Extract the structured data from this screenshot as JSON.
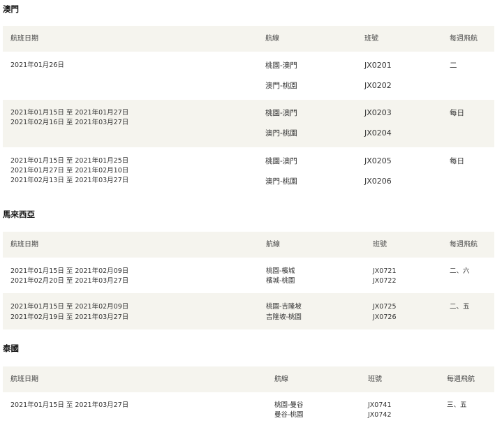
{
  "macau": {
    "title": "澳門",
    "headers": {
      "date": "航班日期",
      "route": "航線",
      "flight": "班號",
      "weekly": "每週飛航"
    },
    "rows": [
      {
        "dates": [
          "2021年01月26日"
        ],
        "routes": [
          "桃園-澳門",
          "澳門-桃園"
        ],
        "flights": [
          "JX0201",
          "JX0202"
        ],
        "weekly": "二"
      },
      {
        "dates": [
          "2021年01月15日 至 2021年01月27日",
          "2021年02月16日 至 2021年03月27日"
        ],
        "routes": [
          "桃園-澳門",
          "澳門-桃園"
        ],
        "flights": [
          "JX0203",
          "JX0204"
        ],
        "weekly": "每日"
      },
      {
        "dates": [
          "2021年01月15日 至 2021年01月25日",
          "2021年01月27日 至 2021年02月10日",
          "2021年02月13日 至 2021年03月27日"
        ],
        "routes": [
          "桃園-澳門",
          "澳門-桃園"
        ],
        "flights": [
          "JX0205",
          "JX0206"
        ],
        "weekly": "每日"
      }
    ]
  },
  "malaysia": {
    "title": "馬來西亞",
    "headers": {
      "date": "航班日期",
      "route": "航線",
      "flight": "班號",
      "weekly": "每週飛航"
    },
    "rows": [
      {
        "dates": [
          "2021年01月15日 至 2021年02月09日",
          "2021年02月20日 至 2021年03月27日"
        ],
        "routes": [
          "桃園-檳城",
          "檳城-桃園"
        ],
        "flights": [
          "JX0721",
          "JX0722"
        ],
        "weekly": "二、六"
      },
      {
        "dates": [
          "2021年01月15日 至 2021年02月09日",
          "2021年02月19日 至 2021年03月27日"
        ],
        "routes": [
          "桃園-吉隆坡",
          "吉隆坡-桃園"
        ],
        "flights": [
          "JX0725",
          "JX0726"
        ],
        "weekly": "二、五"
      }
    ]
  },
  "thailand": {
    "title": "泰國",
    "headers": {
      "date": "航班日期",
      "route": "航線",
      "flight": "班號",
      "weekly": "每週飛航"
    },
    "rows": [
      {
        "dates": [
          "2021年01月15日 至 2021年03月27日"
        ],
        "routes": [
          "桃園-曼谷",
          "曼谷-桃園"
        ],
        "flights": [
          "JX0741",
          "JX0742"
        ],
        "weekly": "三、五"
      }
    ]
  }
}
